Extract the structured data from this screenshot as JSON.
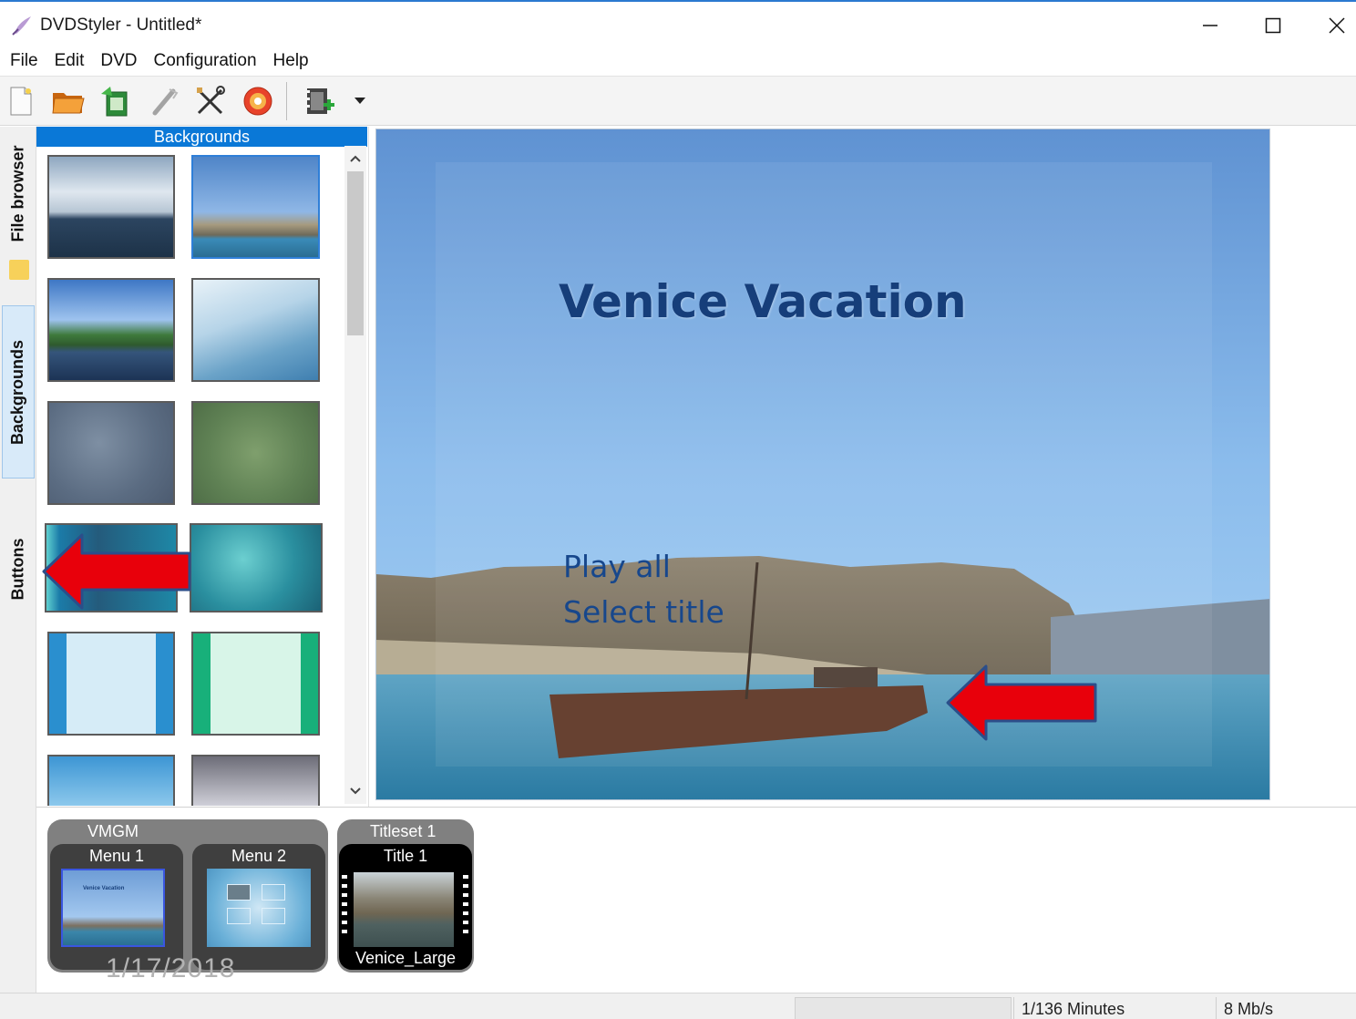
{
  "window": {
    "title": "DVDStyler - Untitled*"
  },
  "menubar": {
    "items": [
      "File",
      "Edit",
      "DVD",
      "Configuration",
      "Help"
    ]
  },
  "toolbar": {
    "buttons": [
      "new-project-icon",
      "open-project-icon",
      "save-project-icon",
      "burn-wand-icon",
      "settings-tools-icon",
      "burn-disc-icon",
      "add-video-icon",
      "dropdown-arrow-icon"
    ]
  },
  "side_tabs": {
    "file_browser": "File browser",
    "backgrounds": "Backgrounds",
    "buttons": "Buttons"
  },
  "panel": {
    "header": "Backgrounds"
  },
  "preview": {
    "title": "Venice Vacation",
    "buttons": [
      "Play all",
      "Select title"
    ]
  },
  "titleset": {
    "vmgm_label": "VMGM",
    "menu1": "Menu 1",
    "menu2": "Menu 2",
    "titleset_label": "Titleset 1",
    "title1": "Title 1",
    "title1_file": "Venice_Large",
    "menu1_thumb_title": "Venice Vacation"
  },
  "watermark": "1/17/2018",
  "status": {
    "duration": "1/136 Minutes",
    "bitrate": "8 Mb/s"
  },
  "colors": {
    "accent": "#0a78d7",
    "annotation_arrow": "#e8000b"
  }
}
